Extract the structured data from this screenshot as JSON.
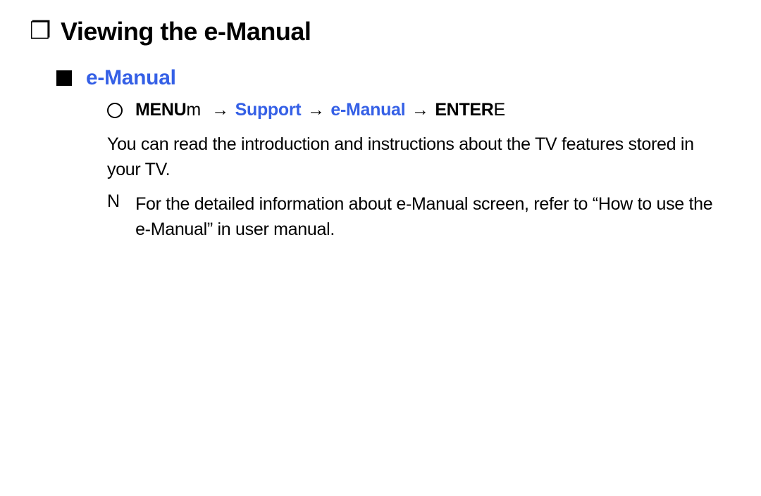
{
  "pageTitle": "Viewing the e-Manual",
  "section": {
    "heading": "e-Manual",
    "navPath": {
      "menuBold": "MENU",
      "menuSuffix": "m",
      "arrow": "→",
      "step1": "Support",
      "step2": "e-Manual",
      "enterBold": "ENTER",
      "enterSuffix": "E"
    },
    "body": "You can read the introduction and instructions about the TV features stored in your TV.",
    "note": {
      "marker": "N",
      "text": "For the detailed information about e-Manual screen, refer to “How to use the e-Manual” in user manual."
    }
  }
}
